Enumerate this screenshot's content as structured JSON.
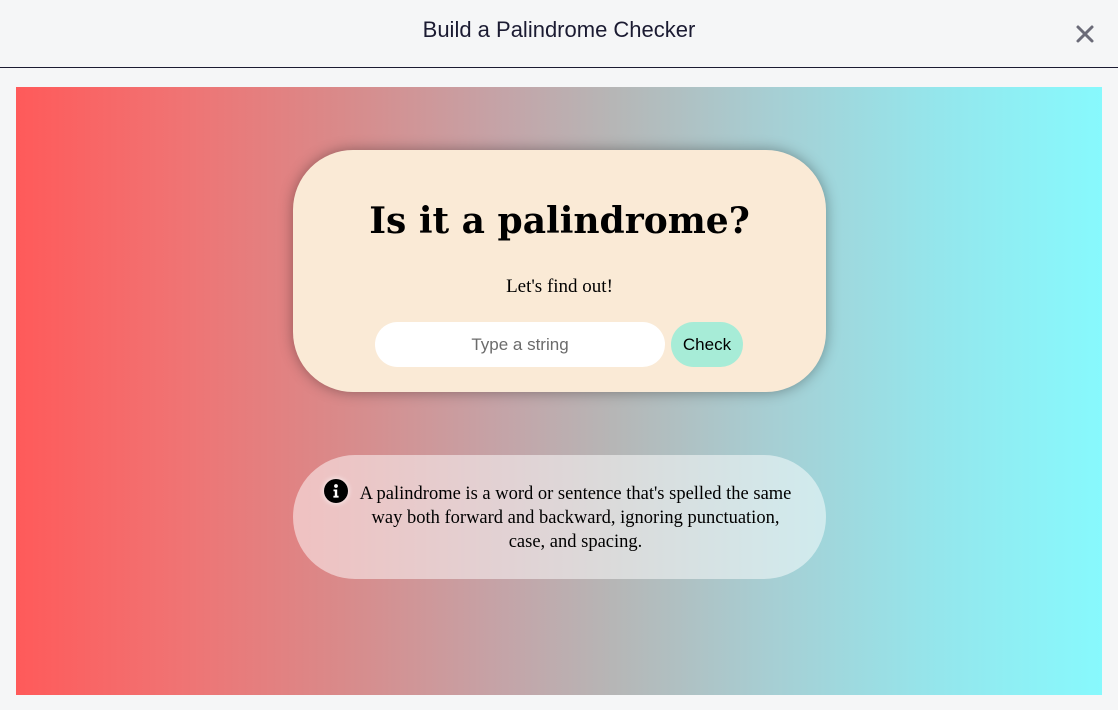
{
  "window": {
    "title": "Build a Palindrome Checker",
    "close_icon": "close-icon"
  },
  "card": {
    "title": "Is it a palindrome?",
    "subtitle": "Let's find out!",
    "input_placeholder": "Type a string",
    "input_value": "",
    "check_label": "Check"
  },
  "info": {
    "icon": "info-circle-icon",
    "text": "A palindrome is a word or sentence that's spelled the same way both forward and backward, ignoring punctuation, case, and spacing."
  },
  "colors": {
    "gradient_start": "#ff5a5a",
    "gradient_end": "#87f9fd",
    "card_background": "#faead6",
    "check_button": "#a7ecd7"
  }
}
